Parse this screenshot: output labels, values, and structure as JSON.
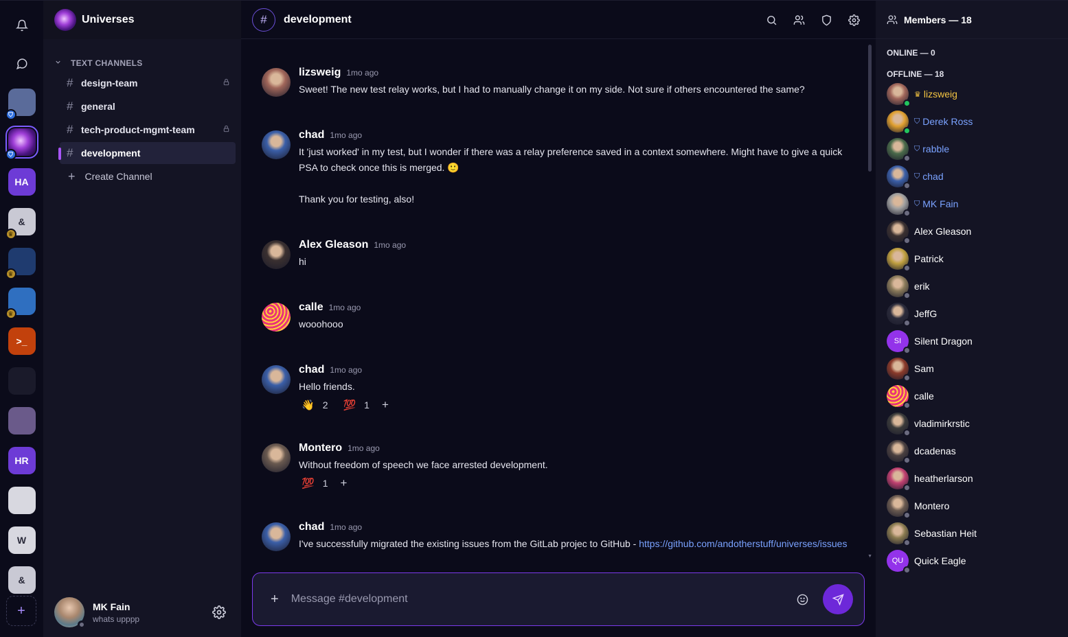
{
  "rail": {
    "servers": [
      {
        "name": "server-1",
        "initials": "",
        "color": "#5a6b9a",
        "badge": "shield"
      },
      {
        "name": "server-universes",
        "initials": "",
        "color": "#3a1a66",
        "badge": "shield",
        "active": true
      },
      {
        "name": "server-ha",
        "initials": "HA",
        "color": "#6d3bd6",
        "badge": ""
      },
      {
        "name": "server-and-other-stuff",
        "initials": "&",
        "color": "#c9c9d4",
        "badge": "crown"
      },
      {
        "name": "server-imaginary",
        "initials": "",
        "color": "#1f3b6f",
        "badge": "crown"
      },
      {
        "name": "server-nodes",
        "initials": "",
        "color": "#2f6fc0",
        "badge": "crown"
      },
      {
        "name": "server-terminal",
        "initials": ">_",
        "color": "#c2410c",
        "badge": ""
      },
      {
        "name": "server-avatar",
        "initials": "",
        "color": "#1a1a2a",
        "badge": ""
      },
      {
        "name": "server-pink",
        "initials": "",
        "color": "#6a5a8a",
        "badge": ""
      },
      {
        "name": "server-hr",
        "initials": "HR",
        "color": "#6d3bd6",
        "badge": ""
      },
      {
        "name": "server-red-logo",
        "initials": "",
        "color": "#d8d8e0",
        "badge": ""
      },
      {
        "name": "server-w",
        "initials": "W",
        "color": "#d8d8e0",
        "badge": ""
      },
      {
        "name": "server-and-other-stuff-2",
        "initials": "&",
        "color": "#c9c9d4",
        "badge": ""
      }
    ]
  },
  "sidebar": {
    "title": "Universes",
    "category": "TEXT CHANNELS",
    "channels": [
      {
        "label": "design-team",
        "locked": true
      },
      {
        "label": "general",
        "locked": false
      },
      {
        "label": "tech-product-mgmt-team",
        "locked": true
      },
      {
        "label": "development",
        "locked": false,
        "active": true
      }
    ],
    "create_label": "Create Channel",
    "user": {
      "name": "MK Fain",
      "status": "whats upppp"
    }
  },
  "header": {
    "channel": "development"
  },
  "messages": [
    {
      "author": "lizsweig",
      "time": "1mo ago",
      "lines": [
        "Sweet! The new test relay works, but I had to manually change it on my side. Not sure if others encountered the same?"
      ],
      "avatar_color": "#a0665a"
    },
    {
      "author": "chad",
      "time": "1mo ago",
      "lines": [
        "It 'just worked' in my test, but I wonder if there was a relay preference saved in a context somewhere. Might have to give a quick",
        "PSA to check once this is merged. 🙂",
        "",
        "Thank you for testing, also!"
      ],
      "avatar_color": "#3b5fa8"
    },
    {
      "author": "Alex Gleason",
      "time": "1mo ago",
      "lines": [
        "hi"
      ],
      "avatar_color": "#3a3030"
    },
    {
      "author": "calle",
      "time": "1mo ago",
      "lines": [
        "wooohooo"
      ],
      "avatar_color": "#e8337a"
    },
    {
      "author": "chad",
      "time": "1mo ago",
      "lines": [
        "Hello friends."
      ],
      "avatar_color": "#3b5fa8",
      "reactions": [
        {
          "emoji": "👋",
          "count": "2"
        },
        {
          "emoji": "💯",
          "count": "1"
        }
      ]
    },
    {
      "author": "Montero",
      "time": "1mo ago",
      "lines": [
        "Without freedom of speech we face arrested development."
      ],
      "avatar_color": "#6a5a50",
      "reactions": [
        {
          "emoji": "💯",
          "count": "1"
        }
      ]
    },
    {
      "author": "chad",
      "time": "1mo ago",
      "lines": [
        "I've successfully migrated the existing issues from the GitLab projec to GitHub - "
      ],
      "link": "https://github.com/andotherstuff/universes/issues",
      "avatar_color": "#3b5fa8"
    }
  ],
  "composer": {
    "placeholder": "Message #development"
  },
  "members": {
    "title": "Members — 18",
    "online_label": "ONLINE — 0",
    "offline_label": "OFFLINE — 18",
    "list": [
      {
        "name": "lizsweig",
        "role": "owner",
        "online": true,
        "color": "#a0665a",
        "initials": ""
      },
      {
        "name": "Derek Ross",
        "role": "mod",
        "online": true,
        "color": "#e0a030",
        "initials": ""
      },
      {
        "name": "rabble",
        "role": "mod",
        "online": false,
        "color": "#4a6a4a",
        "initials": ""
      },
      {
        "name": "chad",
        "role": "mod",
        "online": false,
        "color": "#3b5fa8",
        "initials": ""
      },
      {
        "name": "MK Fain",
        "role": "mod",
        "online": false,
        "color": "#a0a0a0",
        "initials": ""
      },
      {
        "name": "Alex Gleason",
        "role": "",
        "online": false,
        "color": "#3a3030",
        "initials": ""
      },
      {
        "name": "Patrick",
        "role": "",
        "online": false,
        "color": "#c0a040",
        "initials": ""
      },
      {
        "name": "erik",
        "role": "",
        "online": false,
        "color": "#8a7a5a",
        "initials": ""
      },
      {
        "name": "JeffG",
        "role": "",
        "online": false,
        "color": "#2a2a3a",
        "initials": ""
      },
      {
        "name": "Silent Dragon",
        "role": "",
        "online": false,
        "color": "#9333ea",
        "initials": "SI"
      },
      {
        "name": "Sam",
        "role": "",
        "online": false,
        "color": "#8a3a2a",
        "initials": ""
      },
      {
        "name": "calle",
        "role": "",
        "online": false,
        "color": "#e8337a",
        "initials": ""
      },
      {
        "name": "vladimirkrstic",
        "role": "",
        "online": false,
        "color": "#3a3a3a",
        "initials": ""
      },
      {
        "name": "dcadenas",
        "role": "",
        "online": false,
        "color": "#4a4040",
        "initials": ""
      },
      {
        "name": "heatherlarson",
        "role": "",
        "online": false,
        "color": "#c04070",
        "initials": ""
      },
      {
        "name": "Montero",
        "role": "",
        "online": false,
        "color": "#6a5a50",
        "initials": ""
      },
      {
        "name": "Sebastian Heit",
        "role": "",
        "online": false,
        "color": "#8a7a50",
        "initials": ""
      },
      {
        "name": "Quick Eagle",
        "role": "",
        "online": false,
        "color": "#9333ea",
        "initials": "QU"
      }
    ]
  },
  "colors": {
    "accent": "#7c3aed",
    "link": "#7aa2ff",
    "owner": "#f5c542",
    "mod": "#7aa2ff",
    "online": "#22c55e"
  },
  "icons": [
    "bell-icon",
    "chat-icon",
    "search-icon",
    "members-icon",
    "shield-icon",
    "gear-icon",
    "send-icon",
    "emoji-icon",
    "plus-icon",
    "lock-icon",
    "crown-icon"
  ]
}
